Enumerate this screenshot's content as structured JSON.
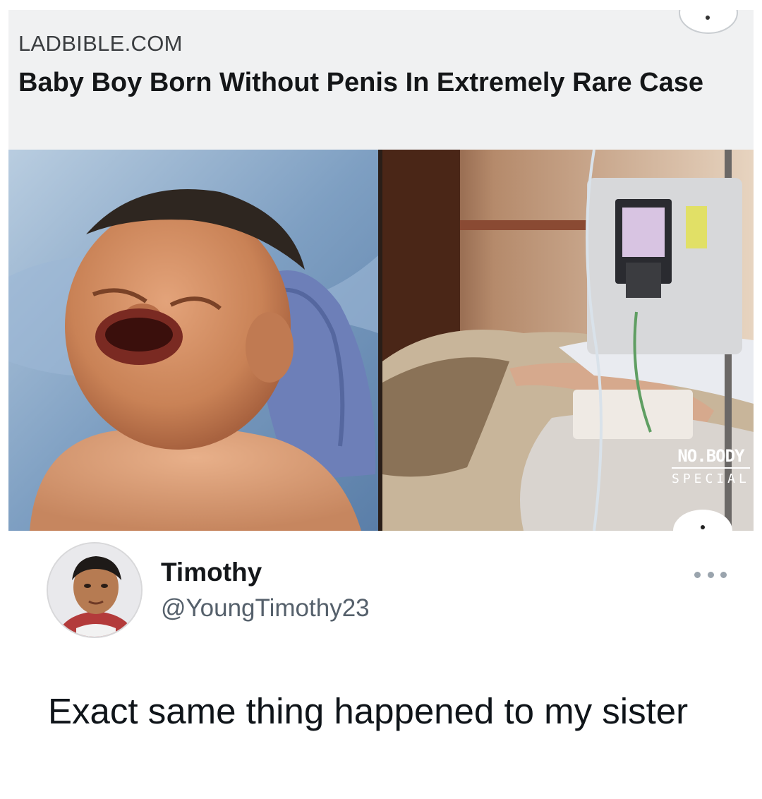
{
  "card": {
    "source": "LADBIBLE.COM",
    "headline": "Baby Boy Born Without Penis In Extremely Rare Case",
    "photo_left": "newborn-baby-crying",
    "photo_right": "hospital-bed-iv-pump",
    "watermark_top": "NO.BODY",
    "watermark_bottom": "SPECIAL"
  },
  "tweet": {
    "name": "Timothy",
    "handle": "@YoungTimothy23",
    "text": "Exact same thing happened to my sister",
    "avatar": "profile-photo",
    "more_icon": "more-horizontal-icon"
  },
  "colors": {
    "card_header_bg": "#f0f1f2",
    "handle_text": "#55606b",
    "more_dots": "#9aa4ad"
  }
}
